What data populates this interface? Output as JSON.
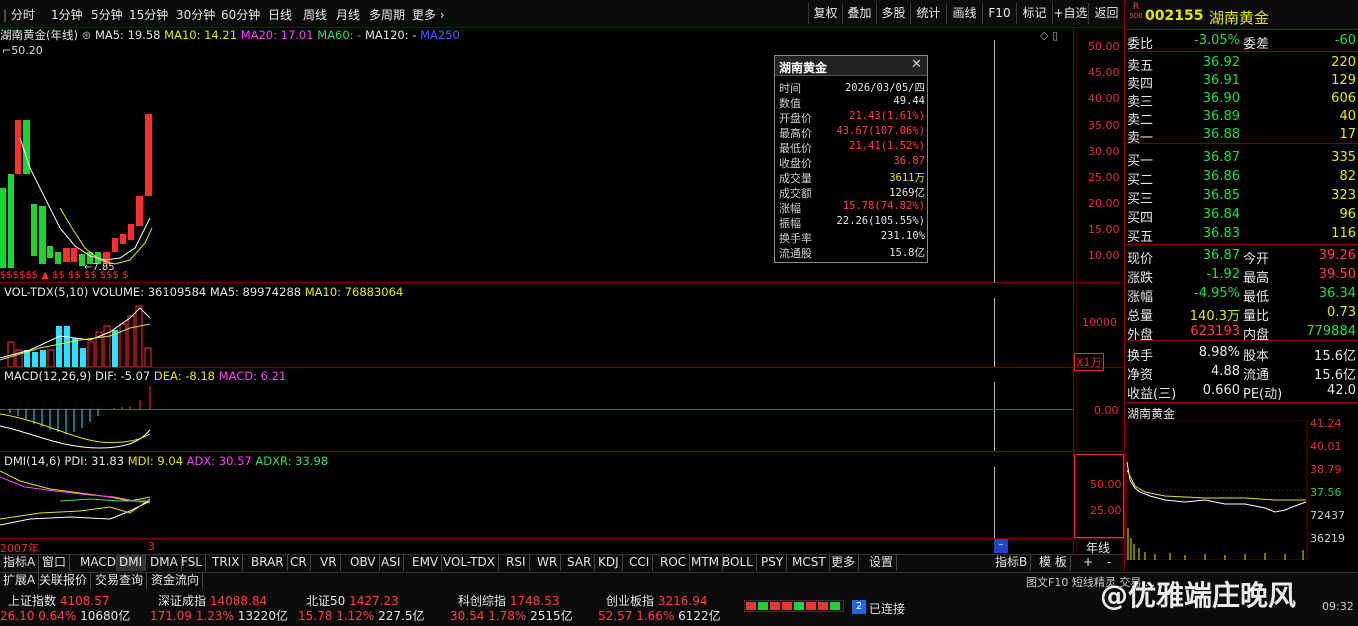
{
  "toolbar": {
    "periods": [
      "分时",
      "1分钟",
      "5分钟",
      "15分钟",
      "30分钟",
      "60分钟",
      "日线",
      "周线",
      "月线",
      "多周期",
      "更多"
    ],
    "more_icon": "chevron-right",
    "tools": [
      "复权",
      "叠加",
      "多股",
      "统计",
      "画线",
      "F10",
      "标记",
      "+自选",
      "返回"
    ]
  },
  "stock": {
    "code": "002155",
    "name": "湖南黄金",
    "badge_top": "R",
    "badge_bottom": "500"
  },
  "main_chart": {
    "title_name": "湖南黄金(年线)",
    "ma5": "MA5: 19.58",
    "ma10": "MA10: 14.21",
    "ma20": "MA20: 17.01",
    "ma60": "MA60: -",
    "ma120": "MA120: -",
    "ma250": "MA250",
    "high_label": "50.20",
    "low_label": "7.85",
    "y_ticks": [
      "50.00",
      "45.00",
      "40.00",
      "35.00",
      "30.00",
      "25.00",
      "20.00",
      "15.00",
      "10.00"
    ]
  },
  "volume": {
    "title": "VOL-TDX(5,10)",
    "vol": "VOLUME: 36109584",
    "ma5": "MA5: 89974288",
    "ma10": "MA10: 76883064",
    "tick": "10000",
    "unit": "X1万"
  },
  "macd": {
    "title": "MACD(12,26,9)",
    "dif": "DIF: -5.07",
    "dea": "DEA: -8.18",
    "macd": "MACD: 6.21",
    "tick": "0.00"
  },
  "dmi": {
    "title": "DMI(14,6)",
    "pdi": "PDI: 31.83",
    "mdi": "MDI: 9.04",
    "adx": "ADX: 30.57",
    "adxr": "ADXR: 33.98",
    "ticks": [
      "50.00",
      "25.00"
    ]
  },
  "time_axis": {
    "start": "2007年",
    "end": "3",
    "period_label": "年线"
  },
  "popup": {
    "title": "湖南黄金",
    "rows": [
      {
        "k": "时间",
        "v": "2026/03/05/四",
        "c": "w"
      },
      {
        "k": "数值",
        "v": "49.44",
        "c": "w"
      },
      {
        "k": "开盘价",
        "v": "21.43(1.61%)",
        "c": "r"
      },
      {
        "k": "最高价",
        "v": "43.67(107.06%)",
        "c": "r"
      },
      {
        "k": "最低价",
        "v": "21.41(1.52%)",
        "c": "r"
      },
      {
        "k": "收盘价",
        "v": "36.87",
        "c": "r"
      },
      {
        "k": "成交量",
        "v": "3611万",
        "c": "y"
      },
      {
        "k": "成交额",
        "v": "1269亿",
        "c": "w"
      },
      {
        "k": "涨幅",
        "v": "15.78(74.82%)",
        "c": "r"
      },
      {
        "k": "振幅",
        "v": "22.26(105.55%)",
        "c": "w"
      },
      {
        "k": "换手率",
        "v": "231.10%",
        "c": "w"
      },
      {
        "k": "流通股",
        "v": "15.8亿",
        "c": "w"
      }
    ]
  },
  "quote": {
    "ratio_label": "委比",
    "ratio": "-3.05%",
    "diff_label": "委差",
    "diff": "-60",
    "asks": [
      {
        "l": "卖五",
        "p": "36.92",
        "v": "220"
      },
      {
        "l": "卖四",
        "p": "36.91",
        "v": "129"
      },
      {
        "l": "卖三",
        "p": "36.90",
        "v": "606"
      },
      {
        "l": "卖二",
        "p": "36.89",
        "v": "40"
      },
      {
        "l": "卖一",
        "p": "36.88",
        "v": "17"
      }
    ],
    "bids": [
      {
        "l": "买一",
        "p": "36.87",
        "v": "335"
      },
      {
        "l": "买二",
        "p": "36.86",
        "v": "82"
      },
      {
        "l": "买三",
        "p": "36.85",
        "v": "323"
      },
      {
        "l": "买四",
        "p": "36.84",
        "v": "96"
      },
      {
        "l": "买五",
        "p": "36.83",
        "v": "116"
      }
    ],
    "stats": [
      {
        "l1": "现价",
        "v1": "36.87",
        "c1": "g",
        "l2": "今开",
        "v2": "39.26",
        "c2": "r"
      },
      {
        "l1": "涨跌",
        "v1": "-1.92",
        "c1": "g",
        "l2": "最高",
        "v2": "39.50",
        "c2": "r"
      },
      {
        "l1": "涨幅",
        "v1": "-4.95%",
        "c1": "g",
        "l2": "最低",
        "v2": "36.34",
        "c2": "g"
      },
      {
        "l1": "总量",
        "v1": "140.3万",
        "c1": "y",
        "l2": "量比",
        "v2": "0.73",
        "c2": "y"
      },
      {
        "l1": "外盘",
        "v1": "623193",
        "c1": "r",
        "l2": "内盘",
        "v2": "779884",
        "c2": "g"
      }
    ],
    "fin": [
      {
        "l1": "换手",
        "v1": "8.98%",
        "l2": "股本",
        "v2": "15.6亿"
      },
      {
        "l1": "净资",
        "v1": "4.88",
        "l2": "流通",
        "v2": "15.6亿"
      },
      {
        "l1": "收益(三)",
        "v1": "0.660",
        "l2": "PE(动)",
        "v2": "42.0"
      }
    ]
  },
  "mini_chart": {
    "title": "湖南黄金",
    "price_ticks": [
      "41.24",
      "40.01",
      "38.79",
      "37.56"
    ],
    "vol_ticks": [
      "72437",
      "36219"
    ]
  },
  "tabs_row1": [
    "指标A",
    "窗口",
    "MACD",
    "DMI",
    "DMA",
    "FSL",
    "TRIX",
    "BRAR",
    "CR",
    "VR",
    "OBV",
    "ASI",
    "EMV",
    "VOL-TDX",
    "RSI",
    "WR",
    "SAR",
    "KDJ",
    "CCI",
    "ROC",
    "MTM",
    "BOLL",
    "PSY",
    "MCST",
    "更多",
    "设置"
  ],
  "tabs_row1_right": [
    "指标B",
    "模 板",
    "+",
    "-"
  ],
  "tabs_row2": [
    "扩展A",
    "关联报价",
    "交易查询",
    "资金流向"
  ],
  "status": {
    "indices": [
      {
        "name": "上证指数",
        "value": "4108.57",
        "chg": "26.10",
        "pct": "0.64%",
        "amt": "10680亿"
      },
      {
        "name": "深证成指",
        "value": "14088.84",
        "chg": "171.09",
        "pct": "1.23%",
        "amt": "13220亿"
      },
      {
        "name": "北证50",
        "value": "1427.23",
        "chg": "15.78",
        "pct": "1.12%",
        "amt": "227.5亿"
      },
      {
        "name": "科创综指",
        "value": "1748.53",
        "chg": "30.54",
        "pct": "1.78%",
        "amt": "2515亿"
      },
      {
        "name": "创业板指",
        "value": "3216.94",
        "chg": "52.57",
        "pct": "1.66%",
        "amt": "6122亿"
      }
    ],
    "connected": "已连接",
    "conn_count": "2",
    "clock": "09:32",
    "watermark": "@优雅端庄晚风",
    "overlay": "图文F10 短线精灵 交易 ..."
  },
  "colors": {
    "up": "#ff3030",
    "down": "#1fd23a",
    "bg": "#000000",
    "grid": "#6a0000"
  }
}
